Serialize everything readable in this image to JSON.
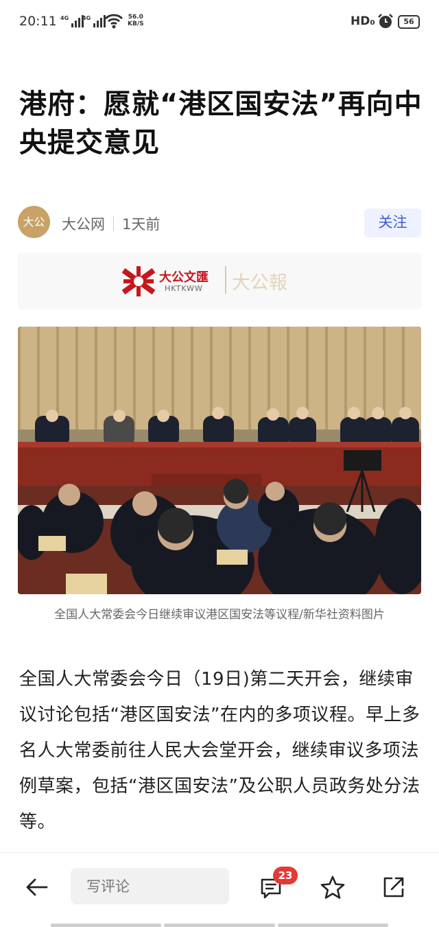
{
  "status_bar": {
    "time": "20:11",
    "network_1": "4G",
    "network_2": "4G",
    "speed_value": "56.0",
    "speed_unit": "KB/S",
    "hd": "HD₀",
    "battery": "56"
  },
  "article": {
    "title": "港府：愿就“港区国安法”再向中央提交意见",
    "author": "大公网",
    "time": "1天前",
    "avatar_text": "大公",
    "follow_label": "关注",
    "logo": {
      "name_cn": "大公文匯",
      "name_en": "HKTKWW",
      "ghost": "大公報"
    },
    "caption": "全国人大常委会今日继续审议港区国安法等议程/新华社资料图片",
    "body": "全国人大常委会今日（19日)第二天开会，继续审议讨论包括“港区国安法”在内的多项议程。早上多名人大常委前往人民大会堂开会，继续审议多项法例草案，包括“港区国安法”及公职人员政务处分法等。"
  },
  "bottom_bar": {
    "comment_placeholder": "写评论",
    "comment_count": "23"
  },
  "colors": {
    "accent": "#3a5bd9",
    "follow_bg": "#eef1ff",
    "badge": "#e53935",
    "logo_red": "#c8161d",
    "avatar_gold": "#c9a268"
  }
}
